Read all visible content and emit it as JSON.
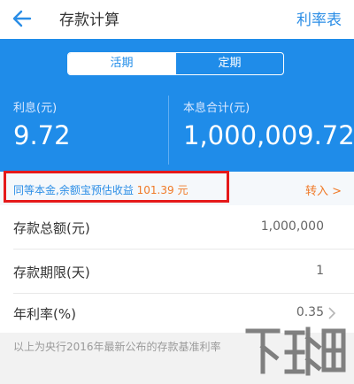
{
  "header": {
    "title": "存款计算",
    "rates_link": "利率表"
  },
  "tabs": [
    {
      "label": "活期",
      "active": true
    },
    {
      "label": "定期",
      "active": false
    }
  ],
  "results": {
    "interest_label": "利息(元)",
    "interest_value": "9.72",
    "total_label": "本息合计(元)",
    "total_value": "1,000,009.72"
  },
  "promo": {
    "text": "同等本金,余额宝预估收益",
    "amount": "101.39 元",
    "action": "转入 >"
  },
  "fields": [
    {
      "label": "存款总额(元)",
      "value": "1,000,000"
    },
    {
      "label": "存款期限(天)",
      "value": "1"
    },
    {
      "label": "年利率(%)",
      "value": "0.35"
    }
  ],
  "footnote": "以上为央行2016年最新公布的存款基准利率",
  "colors": {
    "primary": "#1f8ce9",
    "accent": "#f07a28",
    "highlight_border": "#e5191a"
  },
  "icons": {
    "back": "arrow-left-icon",
    "row_chevron": "chevron-right-icon"
  }
}
